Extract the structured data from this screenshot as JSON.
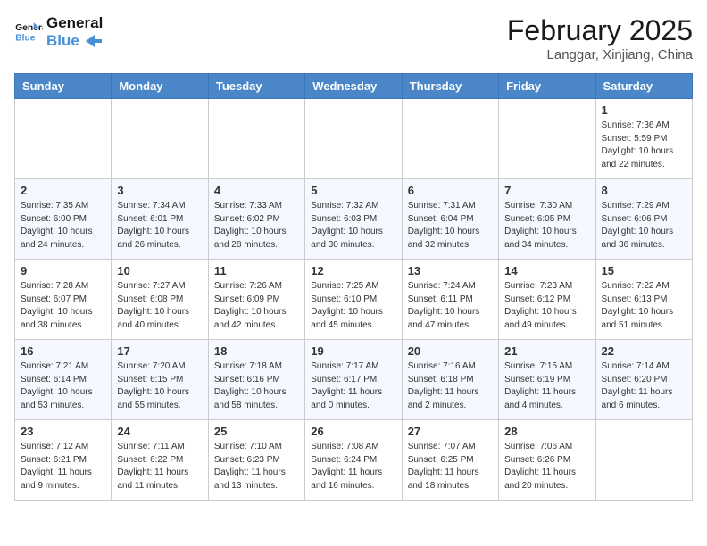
{
  "header": {
    "logo_line1": "General",
    "logo_line2": "Blue",
    "month": "February 2025",
    "location": "Langgar, Xinjiang, China"
  },
  "weekdays": [
    "Sunday",
    "Monday",
    "Tuesday",
    "Wednesday",
    "Thursday",
    "Friday",
    "Saturday"
  ],
  "weeks": [
    [
      null,
      null,
      null,
      null,
      null,
      null,
      {
        "day": "1",
        "sunrise": "7:36 AM",
        "sunset": "5:59 PM",
        "daylight": "10 hours and 22 minutes."
      }
    ],
    [
      {
        "day": "2",
        "sunrise": "7:35 AM",
        "sunset": "6:00 PM",
        "daylight": "10 hours and 24 minutes."
      },
      {
        "day": "3",
        "sunrise": "7:34 AM",
        "sunset": "6:01 PM",
        "daylight": "10 hours and 26 minutes."
      },
      {
        "day": "4",
        "sunrise": "7:33 AM",
        "sunset": "6:02 PM",
        "daylight": "10 hours and 28 minutes."
      },
      {
        "day": "5",
        "sunrise": "7:32 AM",
        "sunset": "6:03 PM",
        "daylight": "10 hours and 30 minutes."
      },
      {
        "day": "6",
        "sunrise": "7:31 AM",
        "sunset": "6:04 PM",
        "daylight": "10 hours and 32 minutes."
      },
      {
        "day": "7",
        "sunrise": "7:30 AM",
        "sunset": "6:05 PM",
        "daylight": "10 hours and 34 minutes."
      },
      {
        "day": "8",
        "sunrise": "7:29 AM",
        "sunset": "6:06 PM",
        "daylight": "10 hours and 36 minutes."
      }
    ],
    [
      {
        "day": "9",
        "sunrise": "7:28 AM",
        "sunset": "6:07 PM",
        "daylight": "10 hours and 38 minutes."
      },
      {
        "day": "10",
        "sunrise": "7:27 AM",
        "sunset": "6:08 PM",
        "daylight": "10 hours and 40 minutes."
      },
      {
        "day": "11",
        "sunrise": "7:26 AM",
        "sunset": "6:09 PM",
        "daylight": "10 hours and 42 minutes."
      },
      {
        "day": "12",
        "sunrise": "7:25 AM",
        "sunset": "6:10 PM",
        "daylight": "10 hours and 45 minutes."
      },
      {
        "day": "13",
        "sunrise": "7:24 AM",
        "sunset": "6:11 PM",
        "daylight": "10 hours and 47 minutes."
      },
      {
        "day": "14",
        "sunrise": "7:23 AM",
        "sunset": "6:12 PM",
        "daylight": "10 hours and 49 minutes."
      },
      {
        "day": "15",
        "sunrise": "7:22 AM",
        "sunset": "6:13 PM",
        "daylight": "10 hours and 51 minutes."
      }
    ],
    [
      {
        "day": "16",
        "sunrise": "7:21 AM",
        "sunset": "6:14 PM",
        "daylight": "10 hours and 53 minutes."
      },
      {
        "day": "17",
        "sunrise": "7:20 AM",
        "sunset": "6:15 PM",
        "daylight": "10 hours and 55 minutes."
      },
      {
        "day": "18",
        "sunrise": "7:18 AM",
        "sunset": "6:16 PM",
        "daylight": "10 hours and 58 minutes."
      },
      {
        "day": "19",
        "sunrise": "7:17 AM",
        "sunset": "6:17 PM",
        "daylight": "11 hours and 0 minutes."
      },
      {
        "day": "20",
        "sunrise": "7:16 AM",
        "sunset": "6:18 PM",
        "daylight": "11 hours and 2 minutes."
      },
      {
        "day": "21",
        "sunrise": "7:15 AM",
        "sunset": "6:19 PM",
        "daylight": "11 hours and 4 minutes."
      },
      {
        "day": "22",
        "sunrise": "7:14 AM",
        "sunset": "6:20 PM",
        "daylight": "11 hours and 6 minutes."
      }
    ],
    [
      {
        "day": "23",
        "sunrise": "7:12 AM",
        "sunset": "6:21 PM",
        "daylight": "11 hours and 9 minutes."
      },
      {
        "day": "24",
        "sunrise": "7:11 AM",
        "sunset": "6:22 PM",
        "daylight": "11 hours and 11 minutes."
      },
      {
        "day": "25",
        "sunrise": "7:10 AM",
        "sunset": "6:23 PM",
        "daylight": "11 hours and 13 minutes."
      },
      {
        "day": "26",
        "sunrise": "7:08 AM",
        "sunset": "6:24 PM",
        "daylight": "11 hours and 16 minutes."
      },
      {
        "day": "27",
        "sunrise": "7:07 AM",
        "sunset": "6:25 PM",
        "daylight": "11 hours and 18 minutes."
      },
      {
        "day": "28",
        "sunrise": "7:06 AM",
        "sunset": "6:26 PM",
        "daylight": "11 hours and 20 minutes."
      },
      null
    ]
  ],
  "labels": {
    "sunrise": "Sunrise:",
    "sunset": "Sunset:",
    "daylight": "Daylight:"
  }
}
